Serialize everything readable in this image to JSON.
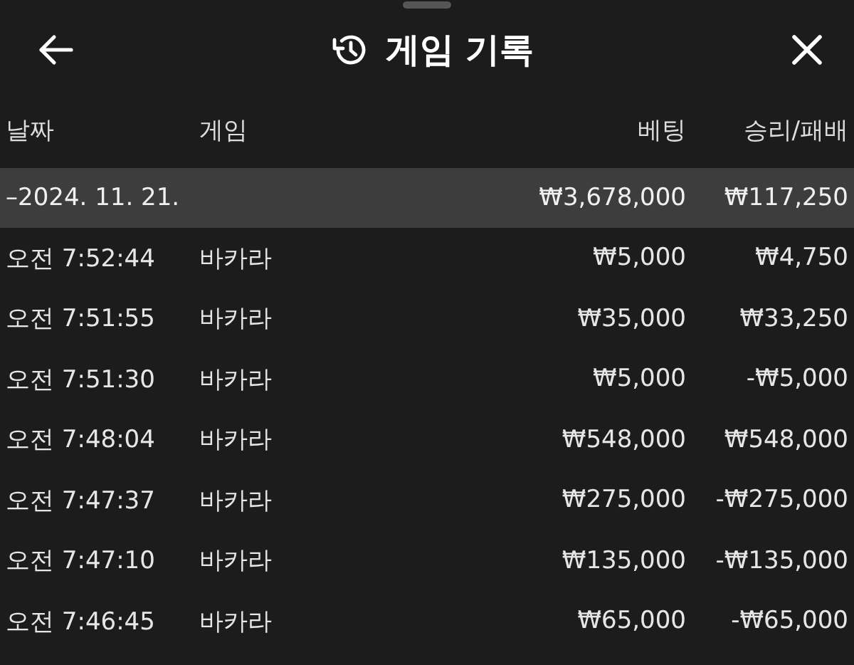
{
  "window": {
    "title": "게임 기록"
  },
  "columns": [
    "날짜",
    "게임",
    "베팅",
    "승리/패배"
  ],
  "group": {
    "date": "–2024. 11. 21.",
    "bet": "₩3,678,000",
    "result": "₩117,250"
  },
  "rows": [
    {
      "time": "오전 7:52:44",
      "game": "바카라",
      "bet": "₩5,000",
      "result": "₩4,750"
    },
    {
      "time": "오전 7:51:55",
      "game": "바카라",
      "bet": "₩35,000",
      "result": "₩33,250"
    },
    {
      "time": "오전 7:51:30",
      "game": "바카라",
      "bet": "₩5,000",
      "result": "-₩5,000"
    },
    {
      "time": "오전 7:48:04",
      "game": "바카라",
      "bet": "₩548,000",
      "result": "₩548,000"
    },
    {
      "time": "오전 7:47:37",
      "game": "바카라",
      "bet": "₩275,000",
      "result": "-₩275,000"
    },
    {
      "time": "오전 7:47:10",
      "game": "바카라",
      "bet": "₩135,000",
      "result": "-₩135,000"
    },
    {
      "time": "오전 7:46:45",
      "game": "바카라",
      "bet": "₩65,000",
      "result": "-₩65,000"
    }
  ]
}
